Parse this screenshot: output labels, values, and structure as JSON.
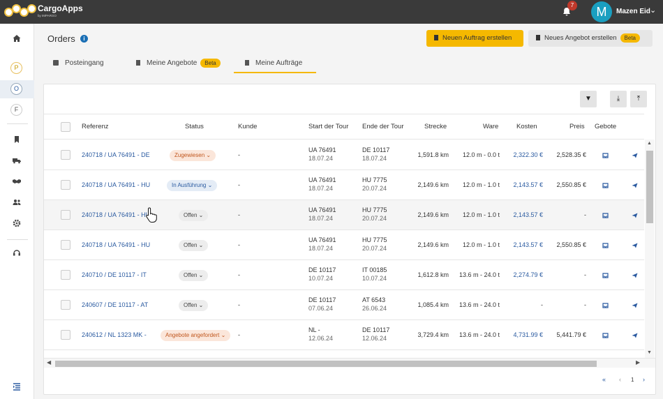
{
  "app": {
    "brand": "CargoApps",
    "brand_sub": "by IMPARGO"
  },
  "topbar": {
    "notification_count": "7",
    "avatar_letter": "M",
    "user_name": "Mazen Eid"
  },
  "sidebar": {
    "circle_items": [
      "P",
      "O",
      "F"
    ]
  },
  "page": {
    "title": "Orders"
  },
  "buttons": {
    "new_order": "Neuen Auftrag erstellen",
    "new_offer": "Neues Angebot erstellen",
    "beta": "Beta"
  },
  "tabs": [
    {
      "label": "Posteingang"
    },
    {
      "label": "Meine Angebote",
      "badge": "Beta"
    },
    {
      "label": "Meine Aufträge",
      "active": true
    }
  ],
  "table": {
    "headers": {
      "ref": "Referenz",
      "status": "Status",
      "kunde": "Kunde",
      "start": "Start der Tour",
      "ende": "Ende der Tour",
      "strecke": "Strecke",
      "ware": "Ware",
      "kosten": "Kosten",
      "preis": "Preis",
      "gebote": "Gebote"
    },
    "rows": [
      {
        "ref": "240718 / UA 76491 - DE",
        "status": "Zugewiesen",
        "kunde": "-",
        "start": "UA 76491",
        "start_date": "18.07.24",
        "ende": "DE 10117",
        "ende_date": "18.07.24",
        "strecke": "1,591.8 km",
        "ware": "12.0 m - 0.0 t",
        "kosten": "2,322.30 €",
        "preis": "2,528.35 €"
      },
      {
        "ref": "240718 / UA 76491 - HU",
        "status": "In Ausführung",
        "kunde": "-",
        "start": "UA 76491",
        "start_date": "18.07.24",
        "ende": "HU 7775",
        "ende_date": "20.07.24",
        "strecke": "2,149.6 km",
        "ware": "12.0 m - 1.0 t",
        "kosten": "2,143.57 €",
        "preis": "2,550.85 €"
      },
      {
        "ref": "240718 / UA 76491 - HU",
        "status": "Offen",
        "kunde": "-",
        "start": "UA 76491",
        "start_date": "18.07.24",
        "ende": "HU 7775",
        "ende_date": "20.07.24",
        "strecke": "2,149.6 km",
        "ware": "12.0 m - 1.0 t",
        "kosten": "2,143.57 €",
        "preis": "-"
      },
      {
        "ref": "240718 / UA 76491 - HU",
        "status": "Offen",
        "kunde": "-",
        "start": "UA 76491",
        "start_date": "18.07.24",
        "ende": "HU 7775",
        "ende_date": "20.07.24",
        "strecke": "2,149.6 km",
        "ware": "12.0 m - 1.0 t",
        "kosten": "2,143.57 €",
        "preis": "2,550.85 €"
      },
      {
        "ref": "240710 / DE 10117 - IT",
        "status": "Offen",
        "kunde": "-",
        "start": "DE 10117",
        "start_date": "10.07.24",
        "ende": "IT 00185",
        "ende_date": "10.07.24",
        "strecke": "1,612.8 km",
        "ware": "13.6 m - 24.0 t",
        "kosten": "2,274.79 €",
        "preis": "-"
      },
      {
        "ref": "240607 / DE 10117 - AT",
        "status": "Offen",
        "kunde": "-",
        "start": "DE 10117",
        "start_date": "07.06.24",
        "ende": "AT 6543",
        "ende_date": "26.06.24",
        "strecke": "1,085.4 km",
        "ware": "13.6 m - 24.0 t",
        "kosten": "-",
        "preis": "-"
      },
      {
        "ref": "240612 / NL 1323 MK -",
        "status": "Angebote angefordert",
        "kunde": "-",
        "start": "NL -",
        "start_date": "12.06.24",
        "ende": "DE 10117",
        "ende_date": "12.06.24",
        "strecke": "3,729.4 km",
        "ware": "13.6 m - 24.0 t",
        "kosten": "4,731.99 €",
        "preis": "5,441.79 €"
      }
    ]
  },
  "pagination": {
    "current": "1"
  }
}
